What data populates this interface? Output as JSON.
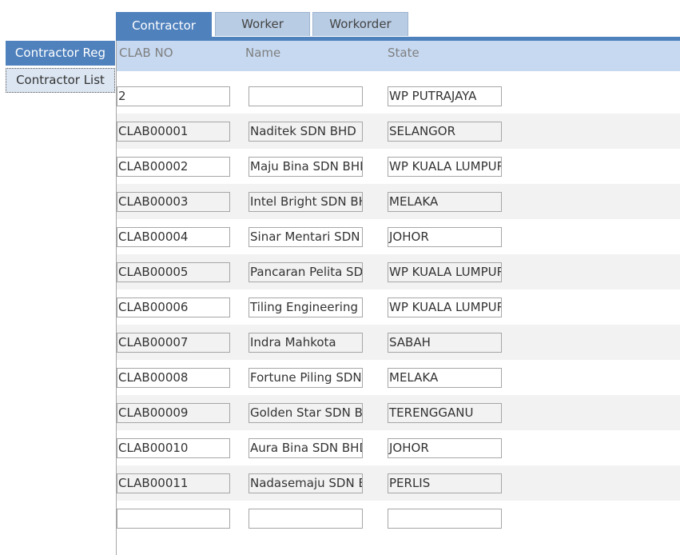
{
  "tabs": [
    "Contractor",
    "Worker",
    "Workorder"
  ],
  "sidebar": {
    "reg_label": "Contractor Reg",
    "list_label": "Contractor List"
  },
  "columns": {
    "clab_no": "CLAB NO",
    "name": "Name",
    "state": "State"
  },
  "rows": [
    {
      "clab_no": "2",
      "name": "",
      "state": "WP PUTRAJAYA"
    },
    {
      "clab_no": "CLAB00001",
      "name": "Naditek SDN BHD",
      "state": "SELANGOR"
    },
    {
      "clab_no": "CLAB00002",
      "name": "Maju Bina SDN BHD",
      "state": "WP KUALA LUMPUR"
    },
    {
      "clab_no": "CLAB00003",
      "name": "Intel Bright SDN BHD",
      "state": "MELAKA"
    },
    {
      "clab_no": "CLAB00004",
      "name": "Sinar Mentari SDN BHD",
      "state": "JOHOR"
    },
    {
      "clab_no": "CLAB00005",
      "name": "Pancaran Pelita SDN BHD",
      "state": "WP KUALA LUMPUR"
    },
    {
      "clab_no": "CLAB00006",
      "name": "Tiling Engineering SDN BHD",
      "state": "WP KUALA LUMPUR"
    },
    {
      "clab_no": "CLAB00007",
      "name": "Indra Mahkota",
      "state": "SABAH"
    },
    {
      "clab_no": "CLAB00008",
      "name": "Fortune Piling SDN BHD",
      "state": "MELAKA"
    },
    {
      "clab_no": "CLAB00009",
      "name": "Golden Star SDN BHD",
      "state": "TERENGGANU"
    },
    {
      "clab_no": "CLAB00010",
      "name": "Aura Bina SDN BHD",
      "state": "JOHOR"
    },
    {
      "clab_no": "CLAB00011",
      "name": "Nadasemaju SDN BHD",
      "state": "PERLIS"
    },
    {
      "clab_no": "",
      "name": "",
      "state": ""
    }
  ]
}
